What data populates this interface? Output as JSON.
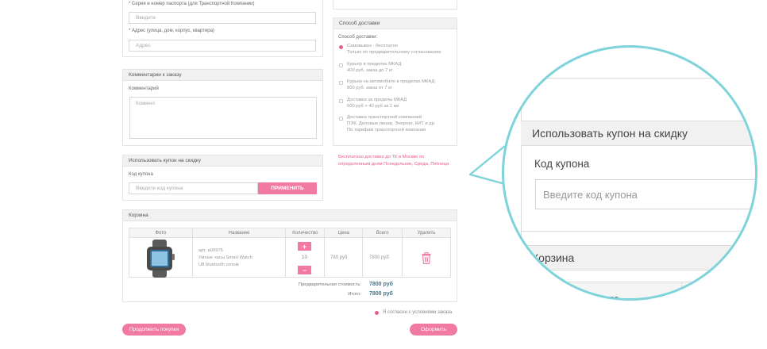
{
  "passport": {
    "label": "* Серия и номер паспорта (для Транспортной Компании)",
    "placeholder": "Введите"
  },
  "address": {
    "label": "* Адрес (улица, дом, корпус, квартира)",
    "placeholder": "Адрес"
  },
  "comment": {
    "header": "Комментарии к заказу",
    "label": "Комментарий",
    "placeholder": "Коммент"
  },
  "coupon": {
    "header": "Использовать купон на скидку",
    "label": "Код купона",
    "placeholder": "Введите код купона",
    "apply_label": "ПРИМЕНИТЬ"
  },
  "delivery": {
    "header": "Способ доставки",
    "label": "Способ доставки:",
    "options": [
      {
        "line1": "Самовывоз - бесплатно",
        "line2": "Только по предварительному согласованию",
        "selected": true
      },
      {
        "line1": "Курьер в пределах МКАД",
        "line2": "400 руб, заказ до 7 кг",
        "selected": false
      },
      {
        "line1": "Курьер на автомобиле в пределах МКАД",
        "line2": "800 руб, заказ от 7 кг",
        "selected": false
      },
      {
        "line1": "Доставка за пределы МКАД",
        "line2": "600 руб + 40 руб за 1 км",
        "selected": false
      },
      {
        "line1": "Доставка транспортной компанией",
        "line2": "ПЭК, Деловые линии, Энергия, КИТ и др.",
        "line3": "По тарифам транспортной компании",
        "selected": false
      }
    ],
    "free_note_line1": "Бесплатная доставка до ТК в Москве по",
    "free_note_line2": "определенным дням Понедельник, Среда, Пятница"
  },
  "cart": {
    "header": "Корзина",
    "columns": [
      "Фото",
      "Название",
      "Количество",
      "Цена",
      "Всего",
      "Удалить"
    ],
    "item": {
      "sku": "арт. а00975",
      "name_line1": "Умные часы Smart Watch",
      "name_line2": "U8 bluetooth оптом",
      "quantity": "10",
      "price": "780 руб",
      "total": "7800 руб"
    },
    "plus": "+",
    "minus": "−",
    "subtotal_label": "Предварительная стоимость:",
    "subtotal_value": "7800 руб",
    "total_label": "Итого:",
    "total_value": "7800 руб"
  },
  "agree_label": "Я согласен с условиями заказа",
  "continue_label": "Продолжить покупки",
  "checkout_label": "Оформить",
  "zoom": {
    "coupon_header": "Использовать купон на скидку",
    "coupon_label": "Код купона",
    "coupon_placeholder": "Введите код купона",
    "cart_header": "Корзина",
    "photo_col": "Фото"
  },
  "colors": {
    "accent": "#f07aa1",
    "bubble_border": "#7fd3da",
    "total_text": "#3d7a99"
  },
  "icons": [
    "trash-icon",
    "watch-image",
    "radio-selected",
    "checkbox-agree"
  ]
}
